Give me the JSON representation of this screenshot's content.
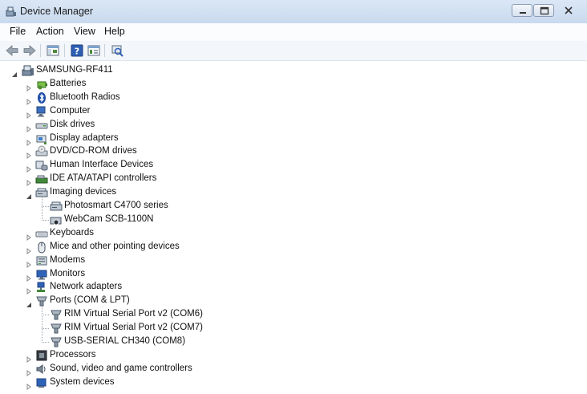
{
  "window": {
    "title": "Device Manager"
  },
  "menu": [
    "File",
    "Action",
    "View",
    "Help"
  ],
  "toolbar": [
    "back-icon",
    "forward-icon",
    "show-hide-tree-icon",
    "help-icon",
    "properties-icon",
    "scan-hardware-icon"
  ],
  "tree": {
    "root": "SAMSUNG-RF411",
    "categories": [
      {
        "label": "Batteries",
        "icon": "battery-icon",
        "expanded": false
      },
      {
        "label": "Bluetooth Radios",
        "icon": "bluetooth-icon",
        "expanded": false
      },
      {
        "label": "Computer",
        "icon": "computer-icon",
        "expanded": false
      },
      {
        "label": "Disk drives",
        "icon": "disk-drive-icon",
        "expanded": false
      },
      {
        "label": "Display adapters",
        "icon": "display-adapter-icon",
        "expanded": false
      },
      {
        "label": "DVD/CD-ROM drives",
        "icon": "dvd-drive-icon",
        "expanded": false
      },
      {
        "label": "Human Interface Devices",
        "icon": "hid-icon",
        "expanded": false
      },
      {
        "label": "IDE ATA/ATAPI controllers",
        "icon": "ide-controller-icon",
        "expanded": false
      },
      {
        "label": "Imaging devices",
        "icon": "imaging-device-icon",
        "expanded": true,
        "children": [
          {
            "label": "Photosmart C4700 series",
            "icon": "scanner-icon"
          },
          {
            "label": "WebCam SCB-1100N",
            "icon": "webcam-icon"
          }
        ]
      },
      {
        "label": "Keyboards",
        "icon": "keyboard-icon",
        "expanded": false
      },
      {
        "label": "Mice and other pointing devices",
        "icon": "mouse-icon",
        "expanded": false
      },
      {
        "label": "Modems",
        "icon": "modem-icon",
        "expanded": false
      },
      {
        "label": "Monitors",
        "icon": "monitor-icon",
        "expanded": false
      },
      {
        "label": "Network adapters",
        "icon": "network-adapter-icon",
        "expanded": false
      },
      {
        "label": "Ports (COM & LPT)",
        "icon": "port-icon",
        "expanded": true,
        "children": [
          {
            "label": "RIM Virtual Serial Port v2 (COM6)",
            "icon": "port-icon"
          },
          {
            "label": "RIM Virtual Serial Port v2 (COM7)",
            "icon": "port-icon"
          },
          {
            "label": "USB-SERIAL CH340 (COM8)",
            "icon": "port-icon"
          }
        ]
      },
      {
        "label": "Processors",
        "icon": "processor-icon",
        "expanded": false
      },
      {
        "label": "Sound, video and game controllers",
        "icon": "sound-icon",
        "expanded": false
      },
      {
        "label": "System devices",
        "icon": "system-device-icon",
        "expanded": false
      }
    ]
  }
}
